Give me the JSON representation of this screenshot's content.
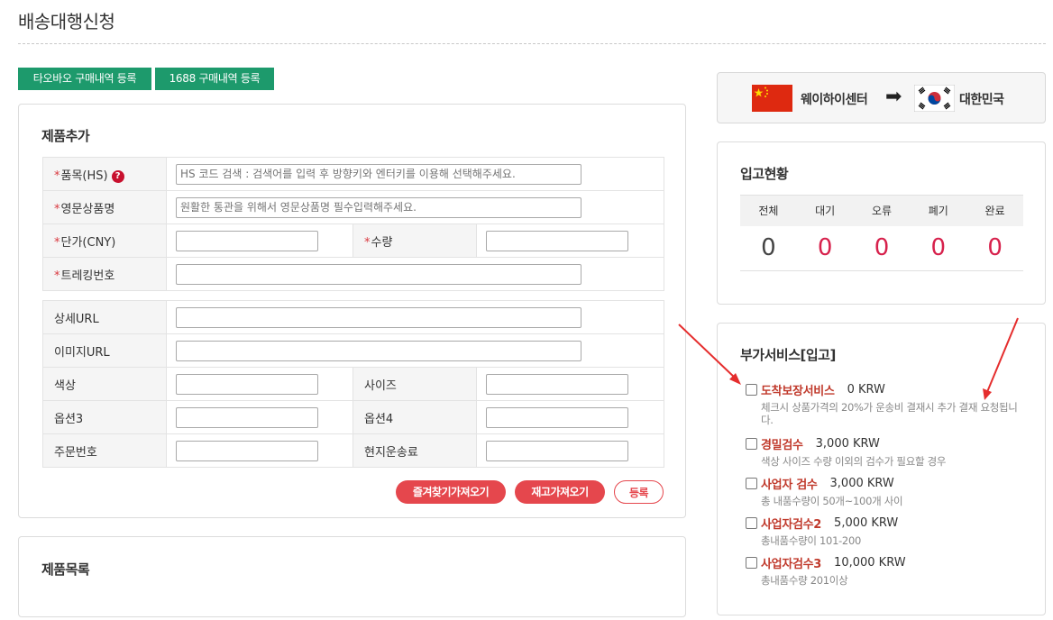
{
  "page": {
    "title": "배송대행신청"
  },
  "buttons": {
    "taobao": "타오바오 구매내역 등록",
    "b1688": "1688 구매내역 등록",
    "favorites": "즐겨찾기가져오기",
    "stock": "재고가져오기",
    "register": "등록"
  },
  "product_add": {
    "title": "제품추가",
    "required_mark": "*",
    "help_icon": "?",
    "hs_label": "품목(HS)",
    "hs_placeholder": "HS 코드 검색 : 검색어를 입력 후 방향키와 엔터키를 이용해 선택해주세요.",
    "eng_label": "영문상품명",
    "eng_placeholder": "원활한 통관을 위해서 영문상품명 필수입력해주세요.",
    "price_label": "단가(CNY)",
    "qty_label": "수량",
    "tracking_label": "트레킹번호",
    "detail_url_label": "상세URL",
    "image_url_label": "이미지URL",
    "color_label": "색상",
    "size_label": "사이즈",
    "option3_label": "옵션3",
    "option4_label": "옵션4",
    "order_no_label": "주문번호",
    "local_shipping_label": "현지운송료"
  },
  "product_list": {
    "title": "제품목록"
  },
  "route": {
    "from": "웨이하이센터",
    "arrow": "➡",
    "to": "대한민국"
  },
  "status": {
    "title": "입고현황",
    "headers": [
      "전체",
      "대기",
      "오류",
      "폐기",
      "완료"
    ],
    "values": [
      "0",
      "0",
      "0",
      "0",
      "0"
    ]
  },
  "extra_services": {
    "title": "부가서비스[입고]",
    "items": [
      {
        "name": "도착보장서비스",
        "price": "0 KRW",
        "desc": "체크시 상품가격의 20%가 운송비 결재시 추가 결재 요청됩니다."
      },
      {
        "name": "경밀검수",
        "price": "3,000 KRW",
        "desc": "색상 사이즈 수량 이외의 검수가 필요할 경우"
      },
      {
        "name": "사업자 검수",
        "price": "3,000 KRW",
        "desc": "총 내품수량이 50개~100개 사이"
      },
      {
        "name": "사업자검수2",
        "price": "5,000 KRW",
        "desc": "총내품수량이 101-200"
      },
      {
        "name": "사업자검수3",
        "price": "10,000 KRW",
        "desc": "총내품수량 201이상"
      }
    ]
  },
  "colors": {
    "green": "#1d9a6c",
    "red": "#e5474d",
    "status_red": "#d7214c",
    "service_red": "#c0392b",
    "annotation_red": "#e52d2d"
  },
  "icons": {
    "arrow": "arrow-right-icon",
    "help": "help-icon",
    "china_flag": "china-flag-icon",
    "korea_flag": "korea-flag-icon"
  }
}
